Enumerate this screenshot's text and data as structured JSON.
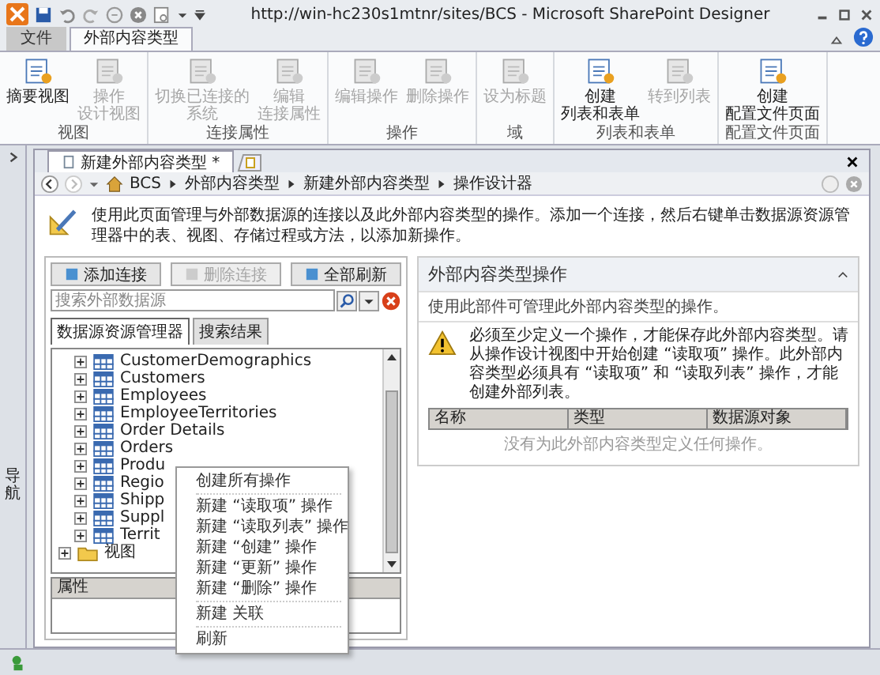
{
  "window": {
    "title": "http://win-hc230s1mtnr/sites/BCS  -  Microsoft SharePoint Designer"
  },
  "ribbon_tabs": [
    {
      "label": "文件",
      "kind": "file",
      "selected": false
    },
    {
      "label": "外部内容类型",
      "kind": "tab",
      "selected": true
    }
  ],
  "ribbon_groups": [
    {
      "label": "视图",
      "buttons": [
        {
          "lines": [
            "摘要视图"
          ],
          "disabled": false
        },
        {
          "lines": [
            "操作",
            "设计视图"
          ],
          "disabled": true
        }
      ]
    },
    {
      "label": "连接属性",
      "buttons": [
        {
          "lines": [
            "切换已连接的",
            "系统"
          ],
          "disabled": true
        },
        {
          "lines": [
            "编辑",
            "连接属性"
          ],
          "disabled": true
        }
      ]
    },
    {
      "label": "操作",
      "buttons": [
        {
          "lines": [
            "编辑操作"
          ],
          "disabled": true
        },
        {
          "lines": [
            "删除操作"
          ],
          "disabled": true
        }
      ]
    },
    {
      "label": "域",
      "buttons": [
        {
          "lines": [
            "设为标题"
          ],
          "disabled": true
        }
      ]
    },
    {
      "label": "列表和表单",
      "buttons": [
        {
          "lines": [
            "创建",
            "列表和表单"
          ],
          "disabled": false
        },
        {
          "lines": [
            "转到列表"
          ],
          "disabled": true
        }
      ]
    },
    {
      "label": "配置文件页面",
      "buttons": [
        {
          "lines": [
            "创建",
            "配置文件页面"
          ],
          "disabled": false
        }
      ]
    }
  ],
  "nav_pane": {
    "label": "导航"
  },
  "document_tab": {
    "label": "新建外部内容类型 *"
  },
  "breadcrumb": [
    "BCS",
    "外部内容类型",
    "新建外部内容类型",
    "操作设计器"
  ],
  "description": "使用此页面管理与外部数据源的连接以及此外部内容类型的操作。添加一个连接，然后右键单击数据源资源管理器中的表、视图、存储过程或方法，以添加新操作。",
  "left_panel": {
    "buttons": [
      {
        "label": "添加连接",
        "disabled": false
      },
      {
        "label": "删除连接",
        "disabled": true
      },
      {
        "label": "全部刷新",
        "disabled": false
      }
    ],
    "search": {
      "placeholder": "搜索外部数据源"
    },
    "tabs": [
      {
        "label": "数据源资源管理器",
        "selected": true
      },
      {
        "label": "搜索结果",
        "selected": false
      }
    ],
    "tree": [
      {
        "label": "CustomerDemographics",
        "kind": "table"
      },
      {
        "label": "Customers",
        "kind": "table"
      },
      {
        "label": "Employees",
        "kind": "table"
      },
      {
        "label": "EmployeeTerritories",
        "kind": "table"
      },
      {
        "label": "Order Details",
        "kind": "table"
      },
      {
        "label": "Orders",
        "kind": "table"
      },
      {
        "label": "Produ",
        "kind": "table"
      },
      {
        "label": "Regio",
        "kind": "table"
      },
      {
        "label": "Shipp",
        "kind": "table"
      },
      {
        "label": "Suppl",
        "kind": "table"
      },
      {
        "label": "Territ",
        "kind": "table"
      },
      {
        "label": "视图",
        "kind": "folder"
      }
    ],
    "properties": {
      "title": "属性"
    }
  },
  "right_panel": {
    "title": "外部内容类型操作",
    "description": "使用此部件可管理此外部内容类型的操作。",
    "warning": "必须至少定义一个操作，才能保存此外部内容类型。请从操作设计视图中开始创建 “读取项” 操作。此外部内容类型必须具有 “读取项” 和 “读取列表” 操作，才能创建外部列表。",
    "columns": [
      "名称",
      "类型",
      "数据源对象"
    ],
    "empty_message": "没有为此外部内容类型定义任何操作。"
  },
  "context_menu": [
    [
      "创建所有操作"
    ],
    [
      "新建 “读取项” 操作",
      "新建 “读取列表” 操作",
      "新建 “创建” 操作",
      "新建 “更新” 操作",
      "新建 “删除” 操作"
    ],
    [
      "新建 关联"
    ],
    [
      "刷新"
    ]
  ]
}
